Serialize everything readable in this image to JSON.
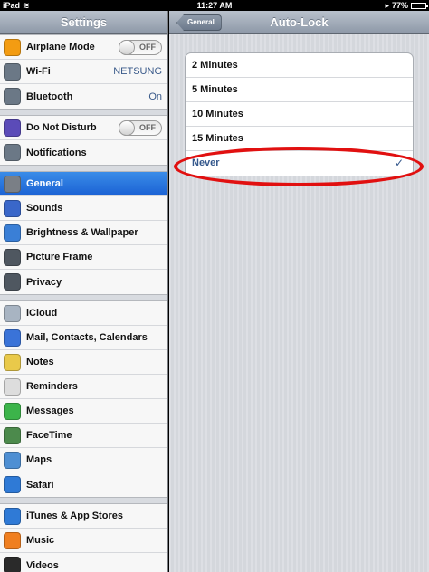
{
  "status_bar": {
    "device": "iPad",
    "time": "11:27 AM",
    "battery": "77%",
    "battery_level": 0.77
  },
  "sidebar": {
    "title": "Settings",
    "groups": [
      [
        {
          "label": "Airplane Mode",
          "icon": "airplane-icon",
          "icon_color": "#f39c12",
          "toggle": "OFF"
        },
        {
          "label": "Wi-Fi",
          "icon": "wifi-icon",
          "icon_color": "#6b7886",
          "value": "NETSUNG"
        },
        {
          "label": "Bluetooth",
          "icon": "bluetooth-icon",
          "icon_color": "#6b7886",
          "value": "On"
        }
      ],
      [
        {
          "label": "Do Not Disturb",
          "icon": "moon-icon",
          "icon_color": "#5b4bb8",
          "toggle": "OFF"
        },
        {
          "label": "Notifications",
          "icon": "notifications-icon",
          "icon_color": "#6b7886"
        }
      ],
      [
        {
          "label": "General",
          "icon": "gear-icon",
          "icon_color": "#7a7f86",
          "selected": true
        },
        {
          "label": "Sounds",
          "icon": "speaker-icon",
          "icon_color": "#3a67c9"
        },
        {
          "label": "Brightness & Wallpaper",
          "icon": "brightness-icon",
          "icon_color": "#3a7fd6"
        },
        {
          "label": "Picture Frame",
          "icon": "picture-frame-icon",
          "icon_color": "#4f5760"
        },
        {
          "label": "Privacy",
          "icon": "hand-icon",
          "icon_color": "#4f5760"
        }
      ],
      [
        {
          "label": "iCloud",
          "icon": "cloud-icon",
          "icon_color": "#a8b4c2"
        },
        {
          "label": "Mail, Contacts, Calendars",
          "icon": "mail-icon",
          "icon_color": "#3a73d8"
        },
        {
          "label": "Notes",
          "icon": "notes-icon",
          "icon_color": "#e9c94a"
        },
        {
          "label": "Reminders",
          "icon": "reminders-icon",
          "icon_color": "#dddddd"
        },
        {
          "label": "Messages",
          "icon": "messages-icon",
          "icon_color": "#3cb44a"
        },
        {
          "label": "FaceTime",
          "icon": "facetime-icon",
          "icon_color": "#4c8a4c"
        },
        {
          "label": "Maps",
          "icon": "maps-icon",
          "icon_color": "#4e8fd3"
        },
        {
          "label": "Safari",
          "icon": "safari-icon",
          "icon_color": "#2f7ad6"
        }
      ],
      [
        {
          "label": "iTunes & App Stores",
          "icon": "app-store-icon",
          "icon_color": "#2f7ad6"
        },
        {
          "label": "Music",
          "icon": "music-icon",
          "icon_color": "#f07f20"
        },
        {
          "label": "Videos",
          "icon": "videos-icon",
          "icon_color": "#2a2a2a"
        }
      ]
    ]
  },
  "main": {
    "back_label": "General",
    "title": "Auto-Lock",
    "options": [
      {
        "label": "2 Minutes",
        "checked": false
      },
      {
        "label": "5 Minutes",
        "checked": false
      },
      {
        "label": "10 Minutes",
        "checked": false
      },
      {
        "label": "15 Minutes",
        "checked": false
      },
      {
        "label": "Never",
        "checked": true
      }
    ],
    "check_glyph": "✓"
  },
  "colors": {
    "selected_blue": "#1b62d4",
    "annotation_red": "#e11010"
  }
}
